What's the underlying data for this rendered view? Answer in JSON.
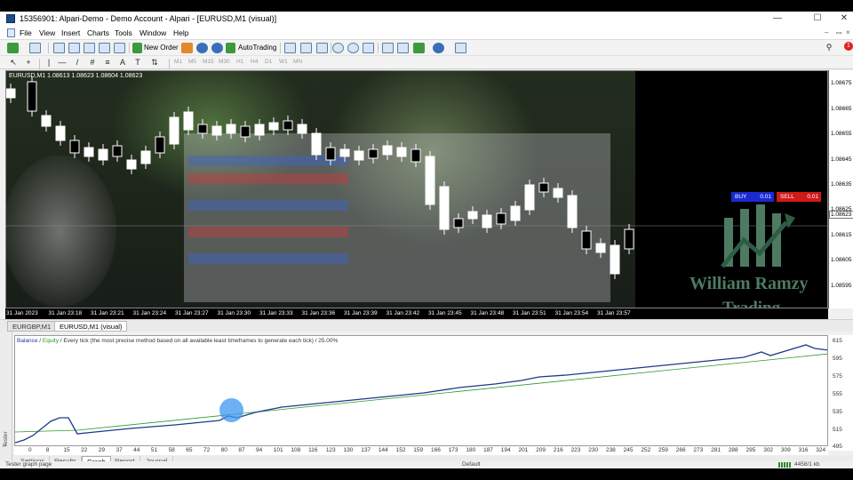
{
  "window": {
    "title": "15356901: Alpari-Demo - Demo Account - Alpari - [EURUSD,M1 (visual)]",
    "minimize": "—",
    "maximize": "☐",
    "close": "✕"
  },
  "menu": {
    "items": [
      "File",
      "View",
      "Insert",
      "Charts",
      "Tools",
      "Window",
      "Help"
    ],
    "restore": "–",
    "pin": "ꟷ",
    "close_child": "×"
  },
  "toolbar": {
    "new_order": "New Order",
    "autotrading": "AutoTrading",
    "notification_count": "1",
    "timeframes": [
      "M1",
      "M5",
      "M15",
      "M30",
      "H1",
      "H4",
      "D1",
      "W1",
      "MN"
    ]
  },
  "chart": {
    "header": "EURUSD,M1  1.08613 1.08623 1.08604 1.08623",
    "buy_label": "BUY",
    "buy_volume": "0.01",
    "sell_label": "SELL",
    "sell_volume": "0.01",
    "current_price": "1.08623",
    "price_ticks": [
      "1.08675",
      "1.08665",
      "1.08655",
      "1.08645",
      "1.08635",
      "1.08625",
      "1.08615",
      "1.08605",
      "1.08595"
    ],
    "time_ticks": [
      "31 Jan 2023",
      "31 Jan 23:18",
      "31 Jan 23:21",
      "31 Jan 23:24",
      "31 Jan 23:27",
      "31 Jan 23:30",
      "31 Jan 23:33",
      "31 Jan 23:36",
      "31 Jan 23:39",
      "31 Jan 23:42",
      "31 Jan 23:45",
      "31 Jan 23:48",
      "31 Jan 23:51",
      "31 Jan 23:54",
      "31 Jan 23:57"
    ],
    "watermark_line1": "William Ramzy",
    "watermark_line2": "Trading",
    "colors": {
      "background": "#000000",
      "bull": "#ffffff",
      "bear": "#ffffff",
      "buy": "#1a2ad0",
      "sell": "#d01a1a"
    }
  },
  "chart_tabs": [
    "EURGBP,M1",
    "EURUSD,M1 (visual)"
  ],
  "graph": {
    "legend_balance": "Balance",
    "legend_sep": " / ",
    "legend_equity": "Equity",
    "legend_rest": " / Every tick (the most precise method based on all available least timeframes to generate each tick) / 25.00%",
    "y_ticks": [
      "615",
      "595",
      "575",
      "555",
      "535",
      "515",
      "495"
    ],
    "x_ticks": [
      "0",
      "8",
      "15",
      "22",
      "29",
      "37",
      "44",
      "51",
      "58",
      "65",
      "72",
      "80",
      "87",
      "94",
      "101",
      "108",
      "116",
      "123",
      "130",
      "137",
      "144",
      "152",
      "159",
      "166",
      "173",
      "180",
      "187",
      "194",
      "201",
      "209",
      "216",
      "223",
      "230",
      "238",
      "245",
      "252",
      "259",
      "266",
      "273",
      "281",
      "288",
      "295",
      "302",
      "309",
      "316",
      "324"
    ],
    "colors": {
      "balance": "#1e3a8a",
      "equity": "#2a9a2a"
    }
  },
  "side_panel": {
    "label": "Tester",
    "close": "×"
  },
  "tester_tabs": [
    "Settings",
    "Results",
    "Graph",
    "Report",
    "Journal"
  ],
  "status": {
    "left": "Tester graph page",
    "middle": "Default",
    "right": "4458/1 kb"
  }
}
